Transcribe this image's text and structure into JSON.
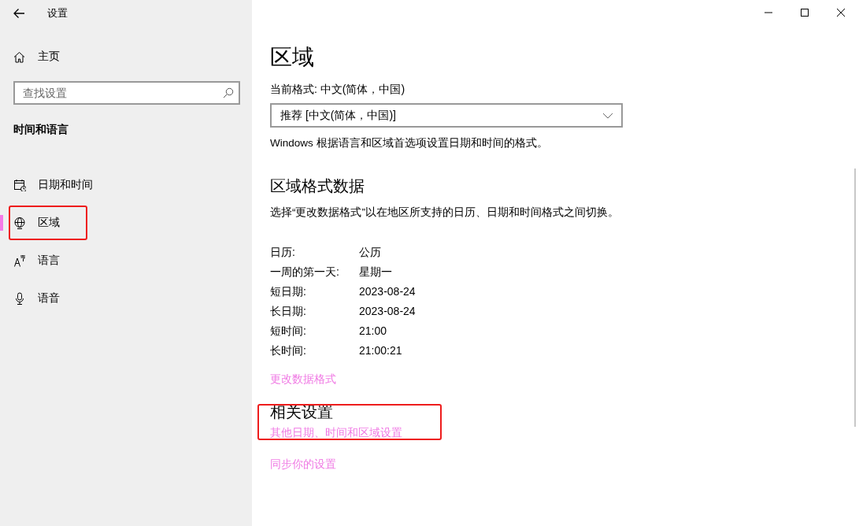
{
  "window": {
    "title": "设置"
  },
  "sidebar": {
    "home": "主页",
    "search": {
      "placeholder": "查找设置"
    },
    "section": "时间和语言",
    "items": [
      {
        "label": "日期和时间",
        "kind": "calendar",
        "selected": false,
        "highlighted": false
      },
      {
        "label": "区域",
        "kind": "globe",
        "selected": true,
        "highlighted": true
      },
      {
        "label": "语言",
        "kind": "language",
        "selected": false,
        "highlighted": false
      },
      {
        "label": "语音",
        "kind": "microphone",
        "selected": false,
        "highlighted": false
      }
    ]
  },
  "main": {
    "title": "区域",
    "current_format": "当前格式: 中文(简体，中国)",
    "format_dropdown": {
      "value": "推荐 [中文(简体，中国)]"
    },
    "format_note": "Windows 根据语言和区域首选项设置日期和时间的格式。",
    "data_heading": "区域格式数据",
    "data_note": "选择“更改数据格式”以在地区所支持的日历、日期和时间格式之间切换。",
    "data_rows": [
      {
        "label": "日历:",
        "value": "公历"
      },
      {
        "label": "一周的第一天:",
        "value": "星期一"
      },
      {
        "label": "短日期:",
        "value": "2023-08-24"
      },
      {
        "label": "长日期:",
        "value": "2023-08-24"
      },
      {
        "label": "短时间:",
        "value": "21:00"
      },
      {
        "label": "长时间:",
        "value": "21:00:21"
      }
    ],
    "change_link": "更改数据格式",
    "related_heading": "相关设置",
    "related_links": [
      {
        "label": "其他日期、时间和区域设置",
        "highlighted": true
      },
      {
        "label": "同步你的设置",
        "highlighted": false
      }
    ]
  }
}
